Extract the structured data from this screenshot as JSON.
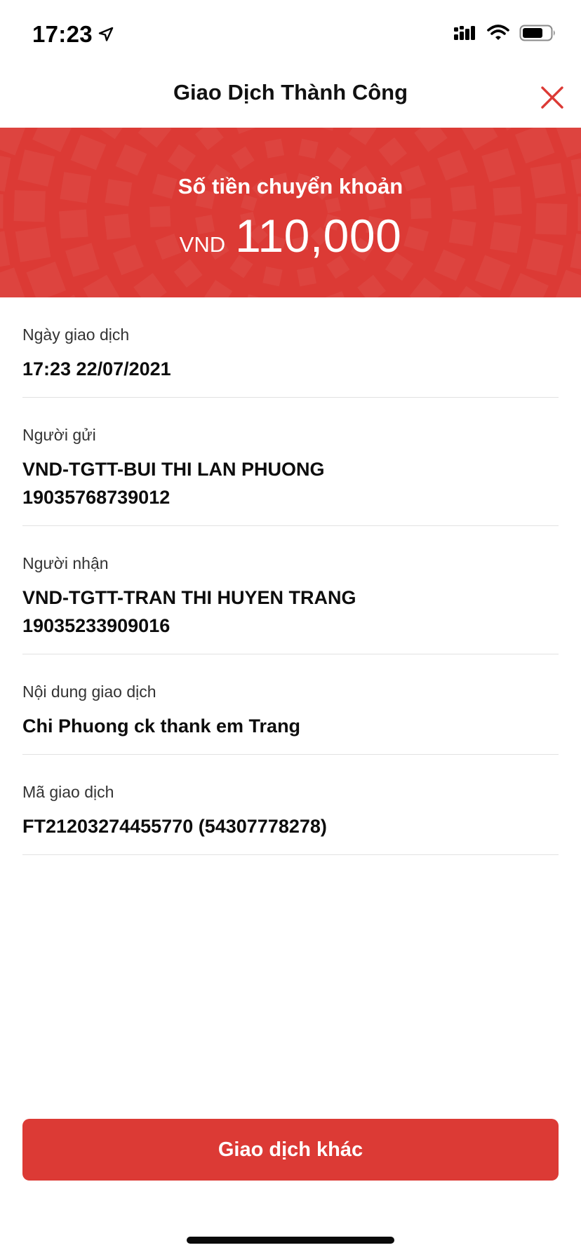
{
  "status_bar": {
    "time": "17:23"
  },
  "header": {
    "title": "Giao Dịch Thành Công"
  },
  "banner": {
    "label": "Số tiền chuyển khoản",
    "currency": "VND",
    "amount": "110,000"
  },
  "details": [
    {
      "label": "Ngày giao dịch",
      "lines": [
        "17:23 22/07/2021"
      ]
    },
    {
      "label": "Người gửi",
      "lines": [
        "VND-TGTT-BUI THI LAN PHUONG",
        "19035768739012"
      ]
    },
    {
      "label": "Người nhận",
      "lines": [
        "VND-TGTT-TRAN THI HUYEN TRANG",
        "19035233909016"
      ]
    },
    {
      "label": "Nội dung giao dịch",
      "lines": [
        "Chi Phuong ck thank em Trang"
      ]
    },
    {
      "label": "Mã giao dịch",
      "lines": [
        "FT21203274455770 (54307778278)"
      ]
    }
  ],
  "actions": {
    "primary_label": "Giao dịch khác"
  },
  "colors": {
    "accent": "#dc3a35"
  }
}
